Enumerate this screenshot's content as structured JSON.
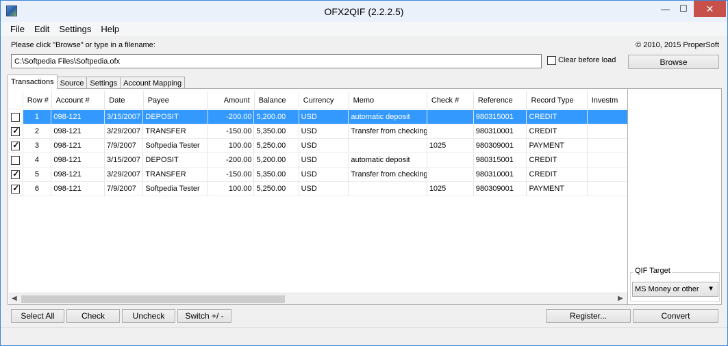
{
  "window": {
    "title": "OFX2QIF (2.2.2.5)",
    "minimize": "—",
    "maximize": "☐",
    "close": "✕"
  },
  "menu": [
    "File",
    "Edit",
    "Settings",
    "Help"
  ],
  "prompt": "Please click \"Browse\" or type in a filename:",
  "copyright": "© 2010, 2015 ProperSoft",
  "file_path": "C:\\Softpedia Files\\Softpedia.ofx",
  "clear_before_load": {
    "label": "Clear before load",
    "checked": false
  },
  "browse_label": "Browse",
  "tabs": [
    "Transactions",
    "Source",
    "Settings",
    "Account Mapping"
  ],
  "active_tab": "Transactions",
  "columns": [
    "Row #",
    "Account #",
    "Date",
    "Payee",
    "Amount",
    "Balance",
    "Currency",
    "Memo",
    "Check #",
    "Reference",
    "Record Type",
    "Investm"
  ],
  "rows": [
    {
      "checked": false,
      "row": "1",
      "account": "098-121",
      "date": "3/15/2007",
      "payee": "DEPOSIT",
      "amount": "-200.00",
      "balance": "5,200.00",
      "currency": "USD",
      "memo": "automatic deposit",
      "check": "",
      "reference": "980315001",
      "type": "CREDIT",
      "selected": true
    },
    {
      "checked": true,
      "row": "2",
      "account": "098-121",
      "date": "3/29/2007",
      "payee": "TRANSFER",
      "amount": "-150.00",
      "balance": "5,350.00",
      "currency": "USD",
      "memo": "Transfer from checking",
      "check": "",
      "reference": "980310001",
      "type": "CREDIT",
      "selected": false
    },
    {
      "checked": true,
      "row": "3",
      "account": "098-121",
      "date": "7/9/2007",
      "payee": "Softpedia Tester",
      "amount": "100.00",
      "balance": "5,250.00",
      "currency": "USD",
      "memo": "",
      "check": "1025",
      "reference": "980309001",
      "type": "PAYMENT",
      "selected": false
    },
    {
      "checked": false,
      "row": "4",
      "account": "098-121",
      "date": "3/15/2007",
      "payee": "DEPOSIT",
      "amount": "-200.00",
      "balance": "5,200.00",
      "currency": "USD",
      "memo": "automatic deposit",
      "check": "",
      "reference": "980315001",
      "type": "CREDIT",
      "selected": false
    },
    {
      "checked": true,
      "row": "5",
      "account": "098-121",
      "date": "3/29/2007",
      "payee": "TRANSFER",
      "amount": "-150.00",
      "balance": "5,350.00",
      "currency": "USD",
      "memo": "Transfer from checking",
      "check": "",
      "reference": "980310001",
      "type": "CREDIT",
      "selected": false
    },
    {
      "checked": true,
      "row": "6",
      "account": "098-121",
      "date": "7/9/2007",
      "payee": "Softpedia Tester",
      "amount": "100.00",
      "balance": "5,250.00",
      "currency": "USD",
      "memo": "",
      "check": "1025",
      "reference": "980309001",
      "type": "PAYMENT",
      "selected": false
    }
  ],
  "qif_target": {
    "label": "QIF Target",
    "value": "MS Money or other"
  },
  "buttons": {
    "select_all": "Select All",
    "check": "Check",
    "uncheck": "Uncheck",
    "switch": "Switch +/ -",
    "register": "Register...",
    "convert": "Convert"
  },
  "colors": {
    "selection": "#3399ff",
    "close_button": "#c7504a",
    "titlebar": "#eaf1fb"
  }
}
